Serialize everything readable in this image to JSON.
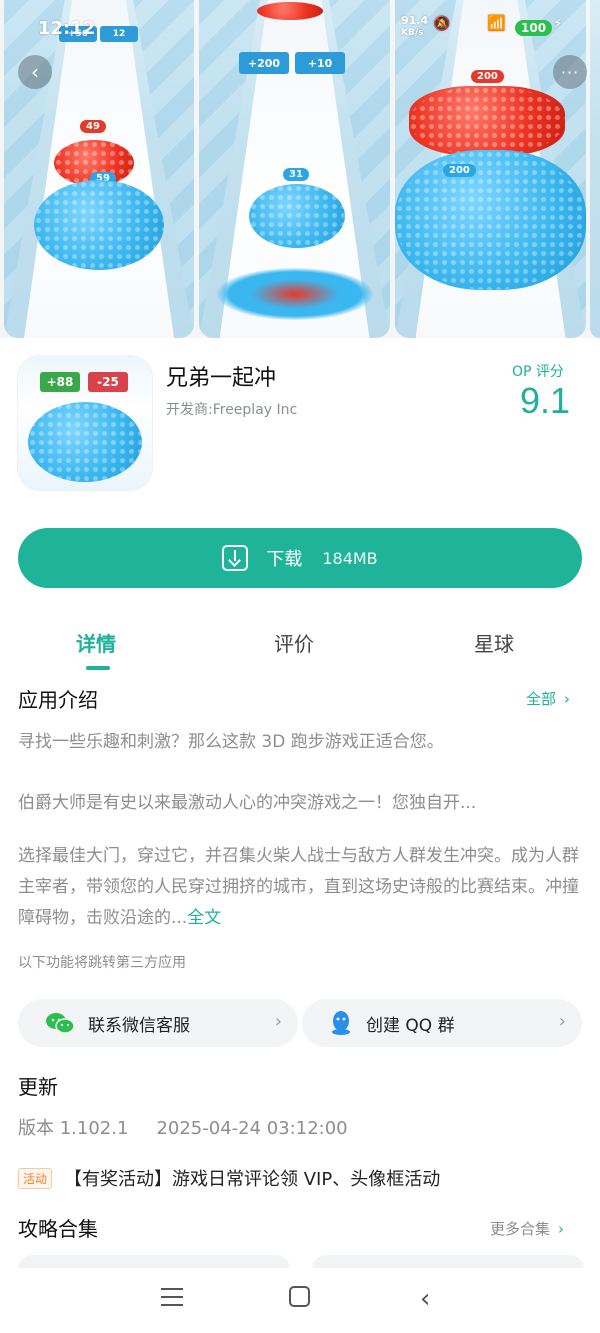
{
  "status_bar": {
    "time": "12:12",
    "speed": "91.4",
    "speed_unit": "KB/s",
    "battery": "100"
  },
  "gallery": {
    "shot1": {
      "red_count": "49",
      "blue_count": "59",
      "gate_left": "+56",
      "gate_right": "12"
    },
    "shot2": {
      "gate_left": "+200",
      "gate_right": "+10",
      "blue_count": "31"
    },
    "shot3": {
      "red_count": "200",
      "blue_count": "200"
    },
    "back_icon": "chevron-left",
    "more_icon": "ellipsis"
  },
  "app": {
    "name": "兄弟一起冲",
    "developer": "开发商:Freeplay Inc",
    "score_label": "OP 评分",
    "score": "9.1",
    "icon_gate_plus": "+88",
    "icon_gate_minus": "-25"
  },
  "download": {
    "label": "下载",
    "size": "184MB"
  },
  "tabs": [
    {
      "label": "详情"
    },
    {
      "label": "评价"
    },
    {
      "label": "星球"
    }
  ],
  "intro": {
    "title": "应用介绍",
    "more": "全部",
    "para1": "寻找一些乐趣和刺激？那么这款 3D 跑步游戏正适合您。",
    "para2": "伯爵大师是有史以来最激动人心的冲突游戏之一！您独自开...",
    "para3": "选择最佳大门，穿过它，并召集火柴人战士与敌方人群发生冲突。成为人群主宰者，带领您的人民穿过拥挤的城市，直到这场史诗般的比赛结束。冲撞障碍物，击败沿途的...",
    "full_text": "全文"
  },
  "third_party": {
    "note": "以下功能将跳转第三方应用",
    "wechat_label": "联系微信客服",
    "qq_label": "创建 QQ 群"
  },
  "update": {
    "title": "更新",
    "version": "版本 1.102.1",
    "date": "2025-04-24 03:12:00"
  },
  "activity": {
    "badge": "活动",
    "text": "【有奖活动】游戏日常评论领 VIP、头像框活动"
  },
  "guides": {
    "title": "攻略合集",
    "more": "更多合集"
  },
  "colors": {
    "accent": "#1fb19a",
    "crowd_blue": "#3bb7f0",
    "crowd_red": "#ee3322"
  }
}
